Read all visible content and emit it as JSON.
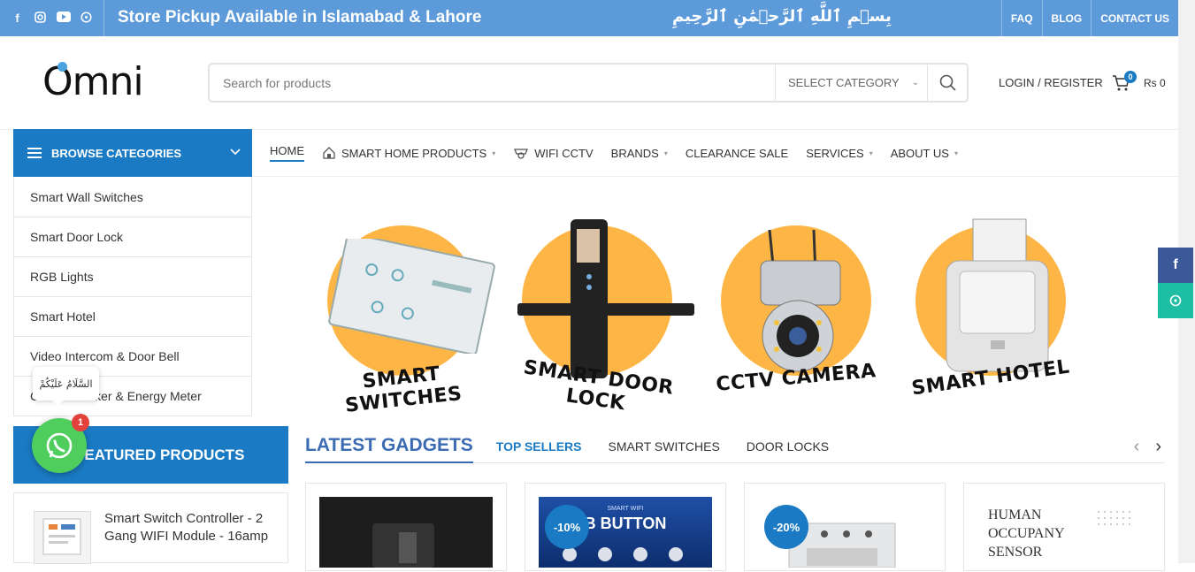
{
  "topbar": {
    "promo": "Store Pickup Available in Islamabad & Lahore",
    "bismillah": "بِسۡمِ ٱللَّهِ ٱلرَّحۡمَٰنِ ٱلرَّحِيمِ",
    "social_icons": [
      "facebook-icon",
      "instagram-icon",
      "youtube-icon",
      "whatsapp-icon"
    ],
    "links": [
      "FAQ",
      "BLOG",
      "CONTACT US"
    ]
  },
  "header": {
    "logo": "Omni",
    "search_placeholder": "Search for products",
    "category_select": "SELECT CATEGORY",
    "login": "LOGIN / REGISTER",
    "cart_count": "0",
    "cart_total": "Rs 0"
  },
  "browse": {
    "label": "BROWSE CATEGORIES"
  },
  "nav": {
    "home": "HOME",
    "smart_home": "SMART HOME PRODUCTS",
    "wifi_cctv": "WIFI CCTV",
    "brands": "BRANDS",
    "clearance": "CLEARANCE SALE",
    "services": "SERVICES",
    "about": "ABOUT US"
  },
  "categories": [
    "Smart Wall Switches",
    "Smart Door Lock",
    "RGB Lights",
    "Smart Hotel",
    "Video Intercom & Door Bell",
    "Circuit Breaker & Energy Meter"
  ],
  "whatsapp": {
    "greeting": "السَّلَامُ عَلَيْكُمْ",
    "unread": "1"
  },
  "featured": {
    "heading": "FEATURED PRODUCTS",
    "product_title": "Smart Switch Controller - 2 Gang WIFI Module - 16amp"
  },
  "banner": {
    "labels": [
      "SMART SWITCHES",
      "SMART DOOR LOCK",
      "CCTV CAMERA",
      "SMART HOTEL"
    ]
  },
  "tabs": {
    "title": "LATEST GADGETS",
    "items": [
      "TOP SELLERS",
      "SMART SWITCHES",
      "DOOR LOCKS"
    ]
  },
  "products": [
    {
      "discount": ""
    },
    {
      "discount": "-10%",
      "img_text": "SMART WIFI",
      "img_big": "B BUTTON"
    },
    {
      "discount": "-20%"
    },
    {
      "discount": "",
      "img_text": "HUMAN OCCUPANY SENSOR"
    }
  ],
  "colors": {
    "topbar": "#5c9ad9",
    "primary": "#1a7bc4",
    "banner_circle": "#fdb646",
    "whatsapp": "#4fce5d"
  }
}
